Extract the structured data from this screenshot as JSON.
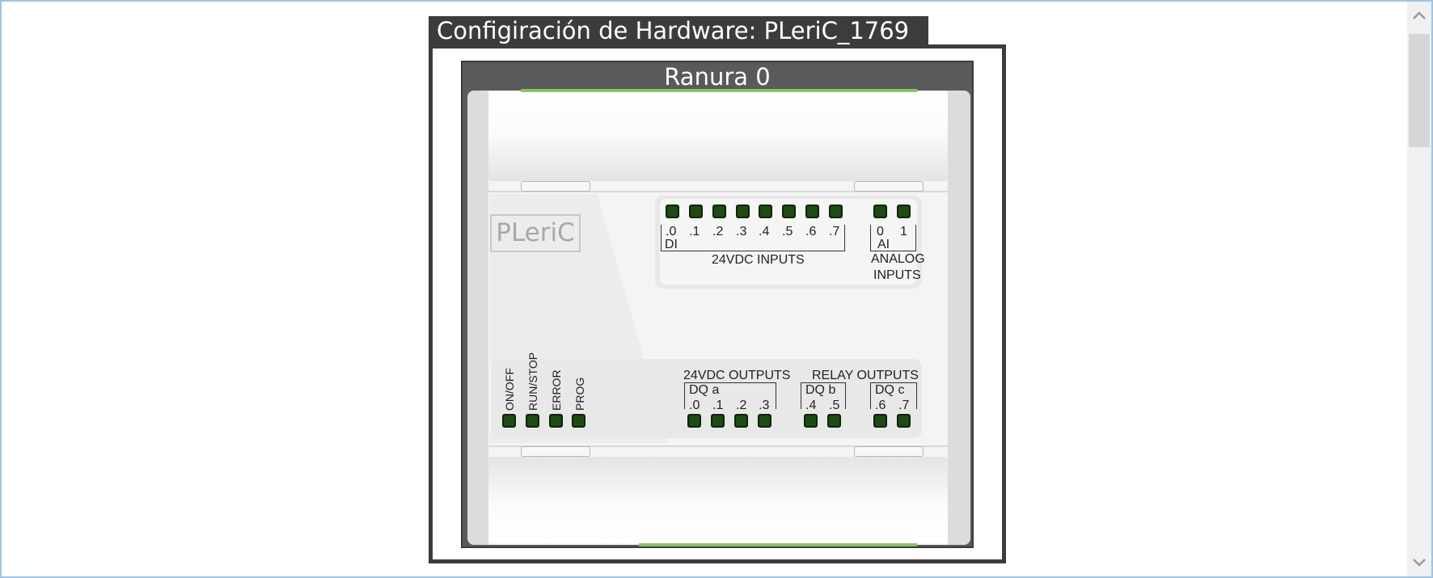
{
  "window": {
    "title": "Configiración de Hardware: PLeriC_1769",
    "slot_title": "Ranura 0"
  },
  "device": {
    "logo": "PLeriC",
    "inputs": {
      "di_labels": [
        ".0",
        ".1",
        ".2",
        ".3",
        ".4",
        ".5",
        ".6",
        ".7"
      ],
      "di_group": "DI",
      "di_caption": "24VDC INPUTS",
      "ai_labels": [
        "0",
        "1"
      ],
      "ai_group": "AI",
      "ai_caption_line1": "ANALOG",
      "ai_caption_line2": "INPUTS"
    },
    "status_leds": [
      "ON/OFF",
      "RUN/STOP",
      "ERROR",
      "PROG"
    ],
    "outputs": {
      "dc_caption": "24VDC OUTPUTS",
      "relay_caption": "RELAY OUTPUTS",
      "dq_a": {
        "name": "DQ a",
        "labels": [
          ".0",
          ".1",
          ".2",
          ".3"
        ]
      },
      "dq_b": {
        "name": "DQ b",
        "labels": [
          ".4",
          ".5"
        ]
      },
      "dq_c": {
        "name": "DQ c",
        "labels": [
          ".6",
          ".7"
        ]
      }
    }
  },
  "colors": {
    "led_off": "#1f4a12",
    "title_bar": "#3c3c3c",
    "slot_bar": "#5a5a5a",
    "accent_strip": "#8cc06a",
    "window_border": "#9ec3e6"
  },
  "icons": {
    "scroll_up": "chevron-up-icon",
    "scroll_down": "chevron-down-icon"
  }
}
